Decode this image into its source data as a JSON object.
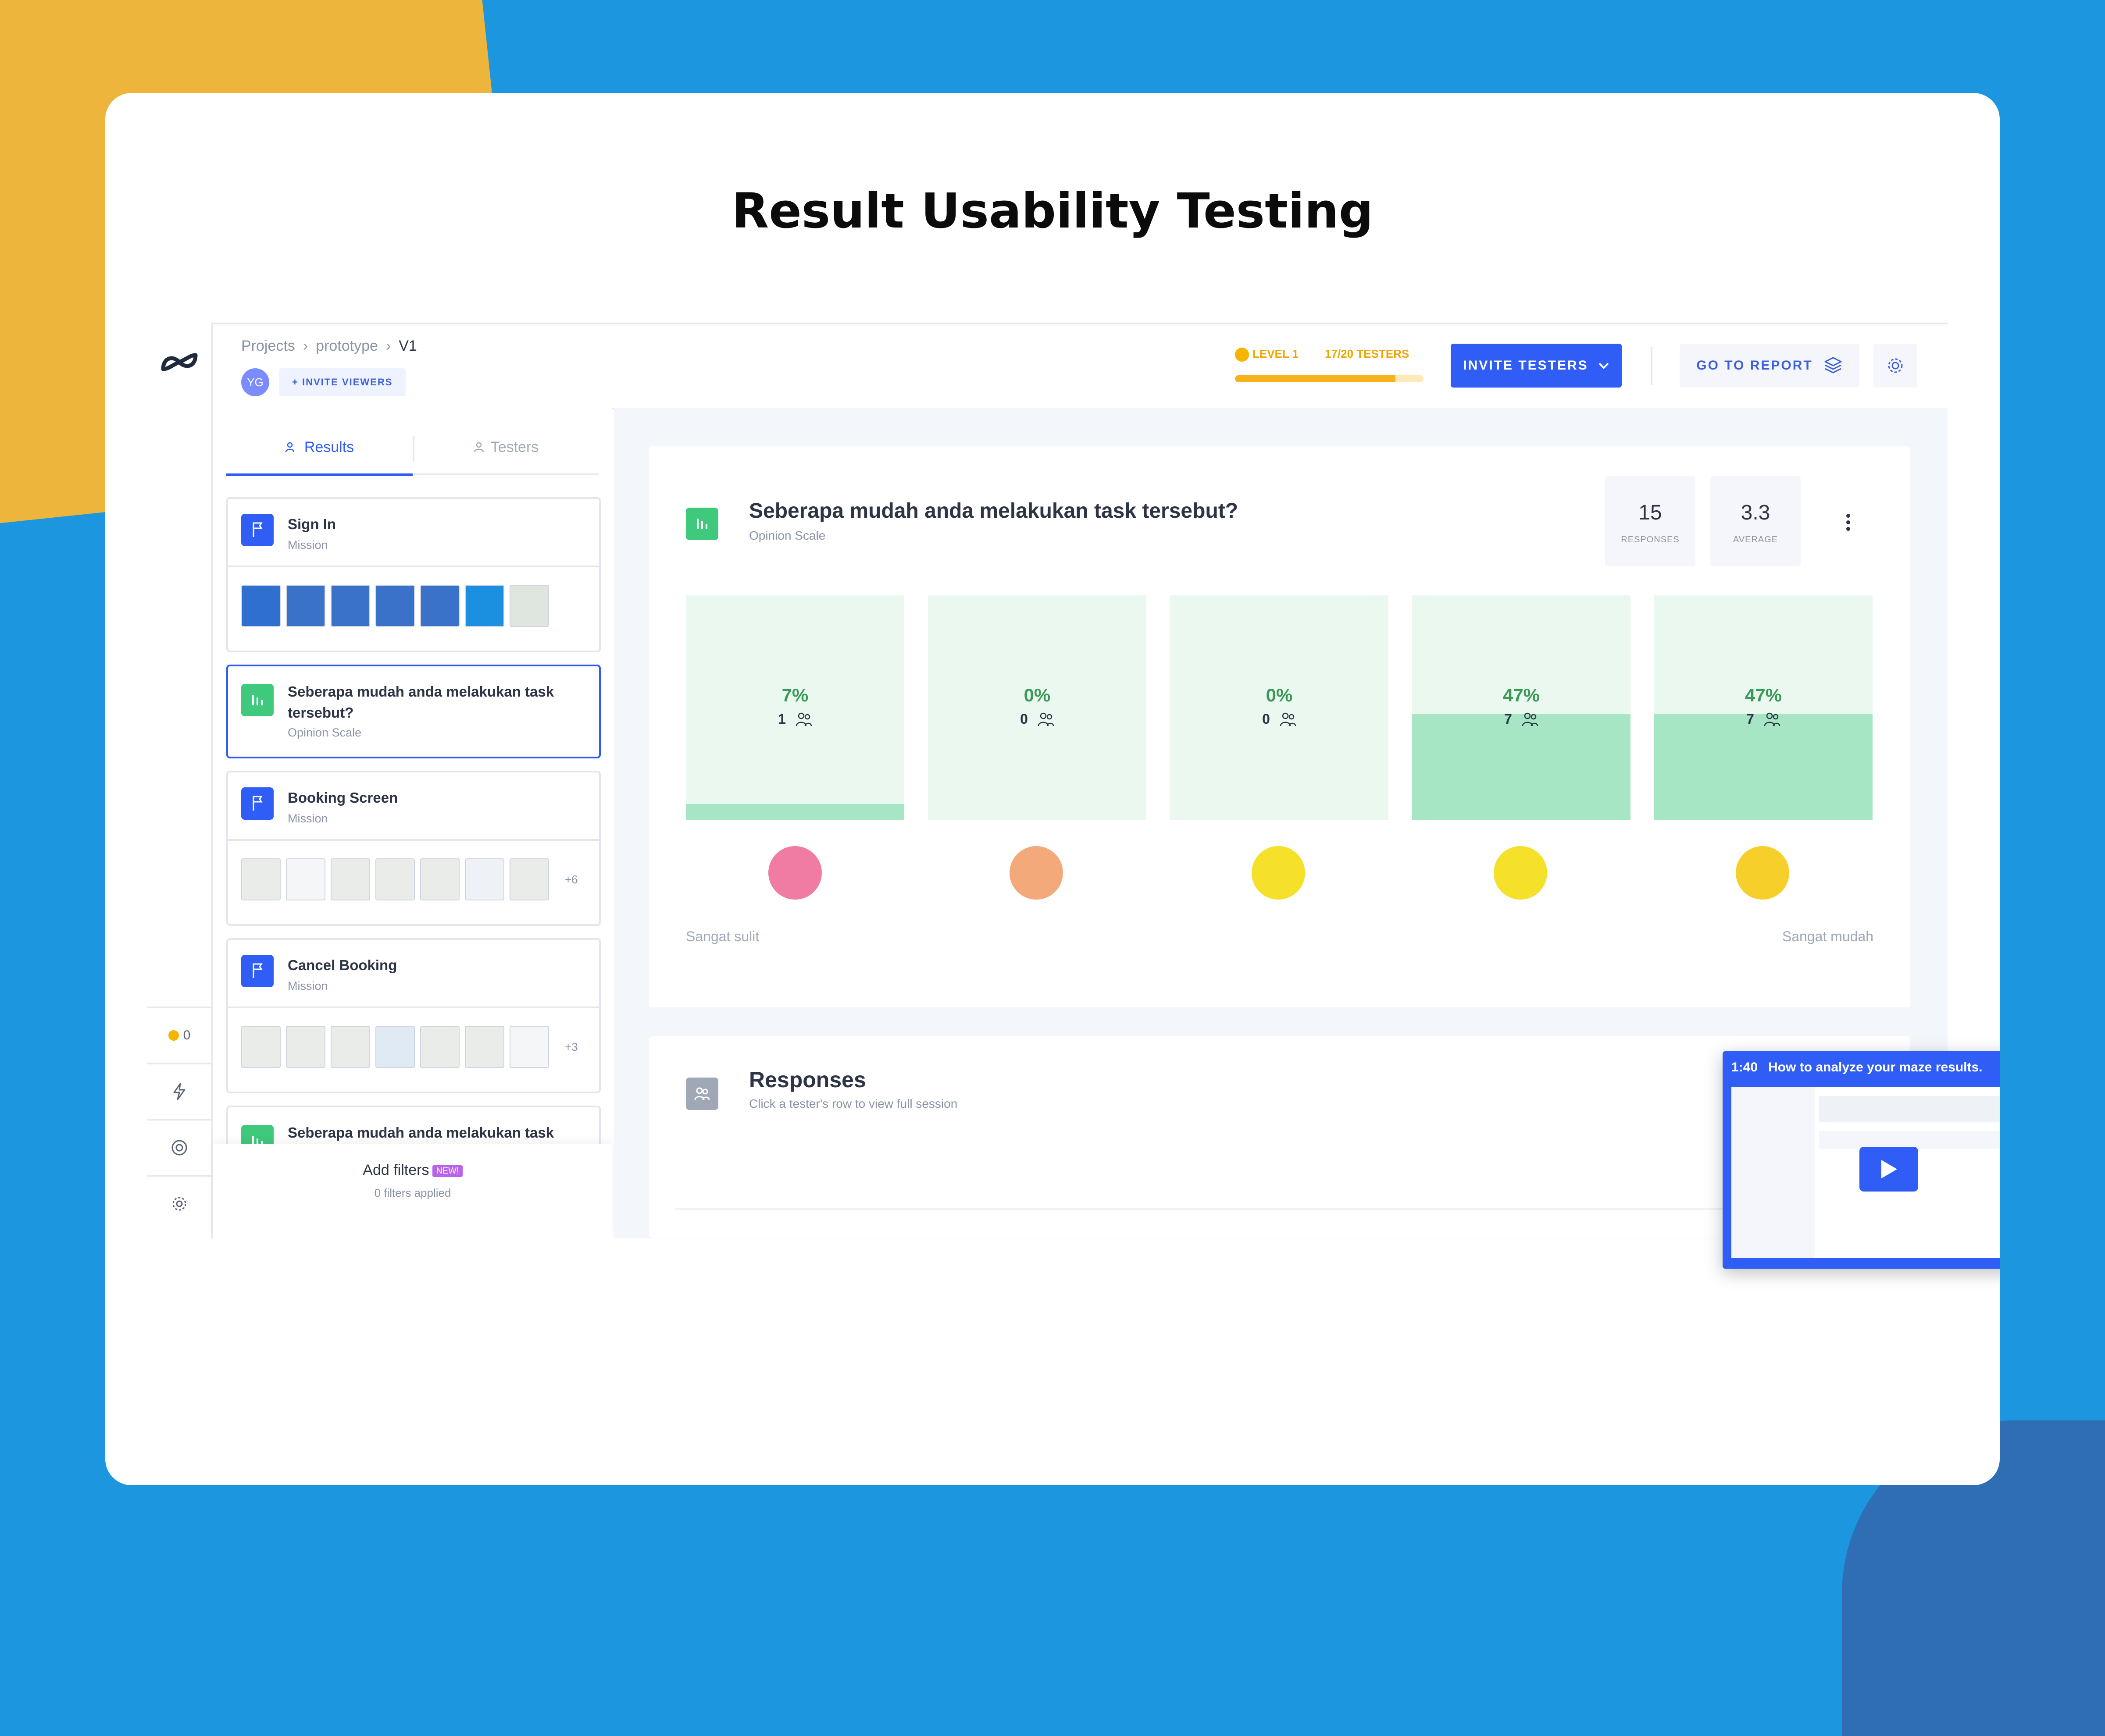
{
  "headline": "Result Usability Testing",
  "breadcrumb": {
    "items": [
      "Projects",
      "prototype",
      "V1"
    ]
  },
  "topbar": {
    "avatar": "YG",
    "invite_viewers": "+ INVITE VIEWERS",
    "level": "LEVEL 1",
    "testers": "17/20 TESTERS",
    "testers_progress": 0.85,
    "invite_testers": "INVITE TESTERS",
    "go_to_report": "GO TO REPORT"
  },
  "rail": {
    "credits": "0"
  },
  "left_tabs": {
    "results": "Results",
    "testers": "Testers"
  },
  "tasks": [
    {
      "title": "Sign In",
      "type": "Mission"
    },
    {
      "title": "Seberapa mudah anda melakukan task tersebut?",
      "type": "Opinion Scale"
    },
    {
      "title": "Booking Screen",
      "type": "Mission",
      "more": "+6"
    },
    {
      "title": "Cancel Booking",
      "type": "Mission",
      "more": "+3"
    },
    {
      "title": "Seberapa mudah anda melakukan task tersebut?",
      "type": ""
    }
  ],
  "filters": {
    "label": "Add filters",
    "badge": "NEW!",
    "applied": "0 filters applied"
  },
  "question": {
    "title": "Seberapa mudah anda melakukan task tersebut?",
    "type": "Opinion Scale",
    "responses_value": "15",
    "responses_label": "RESPONSES",
    "average_value": "3.3",
    "average_label": "AVERAGE",
    "scale_low": "Sangat sulit",
    "scale_high": "Sangat mudah"
  },
  "opinion_bars": [
    {
      "pct": "7%",
      "count": "1",
      "fraction": 0.07,
      "face_color": "#f07ca4"
    },
    {
      "pct": "0%",
      "count": "0",
      "fraction": 0.0,
      "face_color": "#f4a97a"
    },
    {
      "pct": "0%",
      "count": "0",
      "fraction": 0.0,
      "face_color": "#f5e02a"
    },
    {
      "pct": "47%",
      "count": "7",
      "fraction": 0.47,
      "face_color": "#f5e02a"
    },
    {
      "pct": "47%",
      "count": "7",
      "fraction": 0.47,
      "face_color": "#f7cf2a"
    }
  ],
  "responses": {
    "title": "Responses",
    "subtitle": "Click a tester's row to view full session"
  },
  "video": {
    "time": "1:40",
    "title": "How to analyze your maze results."
  },
  "colors": {
    "accent": "#2f5df6",
    "success": "#3fc97d",
    "warning": "#f5b21d"
  }
}
